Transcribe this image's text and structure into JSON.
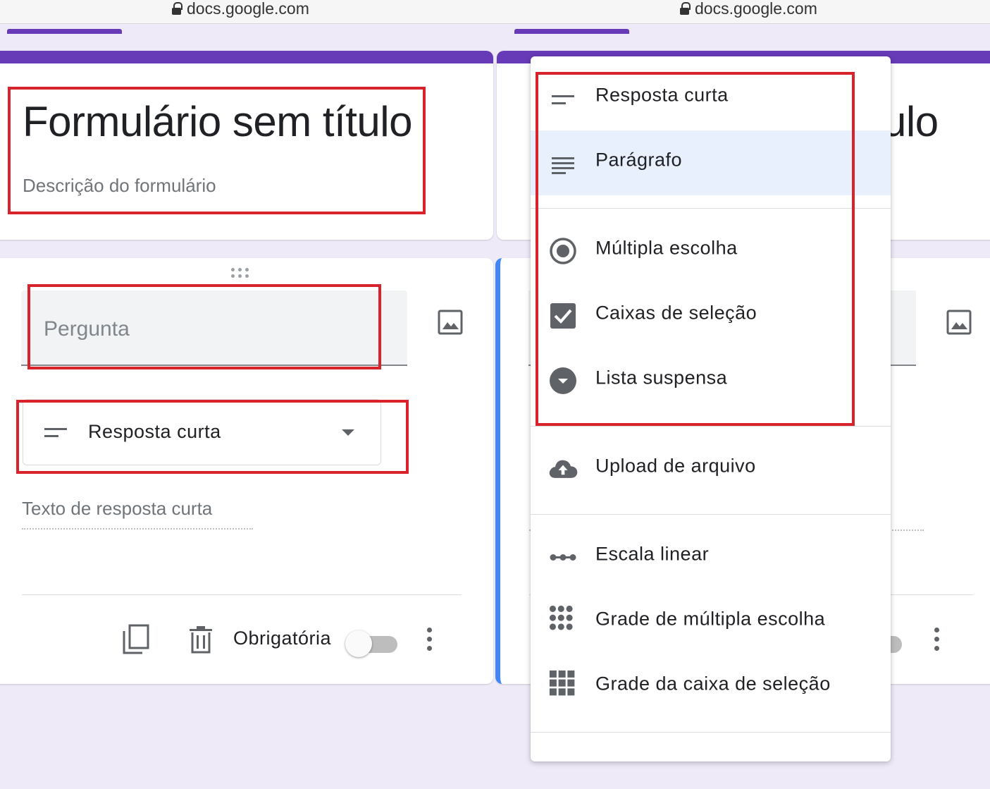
{
  "left": {
    "url": "docs.google.com",
    "form_title": "Formulário sem título",
    "form_description": "Descrição do formulário",
    "question_placeholder": "Pergunta",
    "question_type": "Resposta curta",
    "answer_placeholder": "Texto de resposta curta",
    "required_label": "Obrigatória",
    "required_on": false
  },
  "right": {
    "url": "docs.google.com",
    "form_title_partial": "ulo"
  },
  "menu": {
    "items": [
      {
        "label": "Resposta curta",
        "icon": "short-answer-icon",
        "selected": false
      },
      {
        "label": "Parágrafo",
        "icon": "paragraph-icon",
        "selected": true
      },
      {
        "label": "Múltipla escolha",
        "icon": "radio-button-icon",
        "selected": false
      },
      {
        "label": "Caixas de seleção",
        "icon": "checkbox-icon",
        "selected": false
      },
      {
        "label": "Lista suspensa",
        "icon": "dropdown-icon",
        "selected": false
      },
      {
        "label": "Upload de arquivo",
        "icon": "cloud-upload-icon",
        "selected": false
      },
      {
        "label": "Escala linear",
        "icon": "linear-scale-icon",
        "selected": false
      },
      {
        "label": "Grade de múltipla escolha",
        "icon": "dot-grid-icon",
        "selected": false
      },
      {
        "label": "Grade da caixa de seleção",
        "icon": "square-grid-icon",
        "selected": false
      }
    ]
  },
  "colors": {
    "theme": "#673ab7",
    "active_border": "#4285f4",
    "highlight_box": "#d9232c",
    "selected_item": "#e8f0fe"
  }
}
